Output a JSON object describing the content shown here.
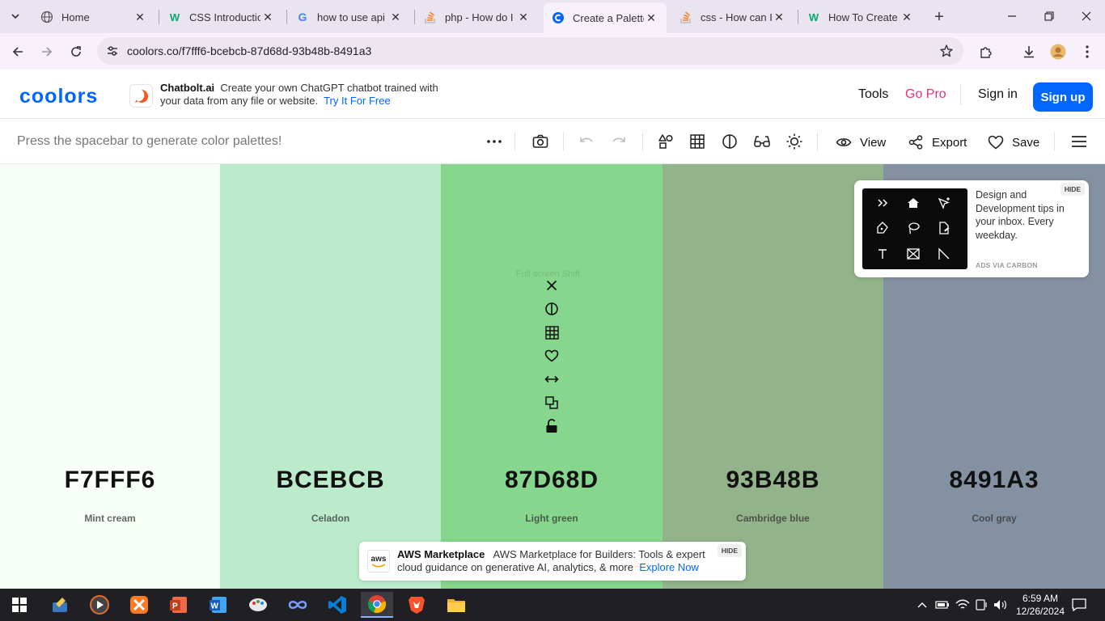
{
  "browser": {
    "tabs": [
      {
        "title": "Home",
        "icon": "home-favicon"
      },
      {
        "title": "CSS Introduction",
        "icon": "w3schools-favicon"
      },
      {
        "title": "how to use api s",
        "icon": "google-favicon"
      },
      {
        "title": "php - How do I",
        "icon": "stackoverflow-favicon"
      },
      {
        "title": "Create a Palette",
        "icon": "coolors-favicon",
        "active": true
      },
      {
        "title": "css - How can I",
        "icon": "stackoverflow-favicon"
      },
      {
        "title": "How To Create a",
        "icon": "w3schools-favicon"
      }
    ],
    "url": "coolors.co/f7fff6-bcebcb-87d68d-93b48b-8491a3"
  },
  "header": {
    "logo": "coolors",
    "ad": {
      "brand": "Chatbolt.ai",
      "text": "Create your own ChatGPT chatbot trained with your data from any file or website.",
      "cta": "Try It For Free"
    },
    "links": {
      "tools": "Tools",
      "go_pro": "Go Pro",
      "sign_in": "Sign in",
      "sign_up": "Sign up"
    }
  },
  "toolbar": {
    "hint": "Press the spacebar to generate color palettes!",
    "view": "View",
    "export": "Export",
    "save": "Save"
  },
  "palette": [
    {
      "hex": "F7FFF6",
      "name": "Mint cream",
      "color": "#F7FFF6"
    },
    {
      "hex": "BCEBCB",
      "name": "Celadon",
      "color": "#BCEBCB"
    },
    {
      "hex": "87D68D",
      "name": "Light green",
      "color": "#87D68D"
    },
    {
      "hex": "93B48B",
      "name": "Cambridge blue",
      "color": "#93B48B"
    },
    {
      "hex": "8491A3",
      "name": "Cool gray",
      "color": "#8491A3"
    }
  ],
  "swatch_tools_tooltip": "Full screen Shift",
  "carbon_ad": {
    "text": "Design and Development tips in your inbox. Every weekday.",
    "via": "ADS VIA CARBON",
    "hide": "HIDE"
  },
  "bottom_ad": {
    "logo": "aws",
    "brand": "AWS Marketplace",
    "text": "AWS Marketplace for Builders: Tools & expert cloud guidance on generative AI, analytics, & more",
    "cta": "Explore Now",
    "hide": "HIDE"
  },
  "taskbar": {
    "time": "6:59 AM",
    "date": "12/26/2024"
  },
  "colors": {
    "brand_blue": "#0066ff",
    "go_pro_pink": "#e72f83",
    "tabstrip": "#e9e4ef",
    "taskbar": "#1f1f24"
  }
}
